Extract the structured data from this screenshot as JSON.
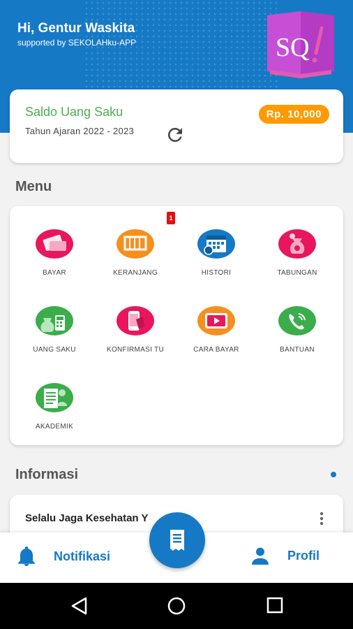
{
  "header": {
    "greeting": "Hi, Gentur Waskita",
    "supported": "supported by SEKOLAHku-APP",
    "logo_text": "SQ!"
  },
  "saldo": {
    "title": "Saldo Uang Saku",
    "year": "Tahun Ajaran 2022 - 2023",
    "amount": "Rp. 10,000",
    "refresh_icon": "refresh-icon"
  },
  "menu": {
    "title": "Menu",
    "items": [
      {
        "label": "BAYAR",
        "icon": "payment-card-icon",
        "color": "#e8175d"
      },
      {
        "label": "KERANJANG",
        "icon": "cart-icon",
        "color": "#f5901e"
      },
      {
        "label": "HISTORI",
        "icon": "calendar-history-icon",
        "color": "#1679c5"
      },
      {
        "label": "TABUNGAN",
        "icon": "savings-bag-icon",
        "color": "#e8175d"
      },
      {
        "label": "UANG SAKU",
        "icon": "money-calculator-icon",
        "color": "#3bad4a"
      },
      {
        "label": "KONFIRMASI TU",
        "icon": "phone-confirm-icon",
        "color": "#e8175d"
      },
      {
        "label": "CARA BAYAR",
        "icon": "video-play-icon",
        "color": "#f5901e"
      },
      {
        "label": "BANTUAN",
        "icon": "phone-call-icon",
        "color": "#3bad4a"
      },
      {
        "label": "AKADEMIK",
        "icon": "document-student-icon",
        "color": "#3bad4a"
      }
    ],
    "cart_badge": "1"
  },
  "informasi": {
    "title": "Informasi",
    "item_title": "Selalu Jaga Kesehatan Y"
  },
  "bottom_nav": {
    "notif_label": "Notifikasi",
    "profil_label": "Profil"
  },
  "colors": {
    "primary": "#1679c5",
    "accent": "#ff9a00",
    "green": "#4caf50"
  }
}
